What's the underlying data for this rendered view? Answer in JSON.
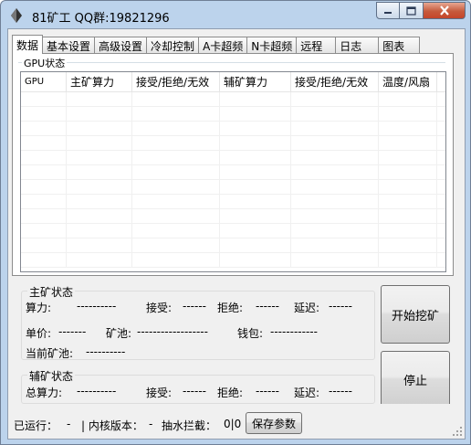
{
  "window": {
    "title": "81矿工  QQ群:19821296",
    "controls": {
      "minimize": "minimize",
      "maximize": "maximize",
      "close": "close"
    }
  },
  "tabs": [
    "数据",
    "基本设置",
    "高级设置",
    "冷却控制",
    "A卡超频",
    "N卡超频",
    "远程",
    "日志",
    "图表"
  ],
  "active_tab": "数据",
  "gpu_status": {
    "group_label": "GPU状态",
    "columns": [
      "GPU",
      "主矿算力",
      "接受/拒绝/无效",
      "辅矿算力",
      "接受/拒绝/无效",
      "温度/风扇"
    ],
    "rows": []
  },
  "main_status": {
    "group_label": "主矿状态",
    "hashrate_label": "算力:",
    "hashrate_value": "----------",
    "accepted_label": "接受:",
    "accepted_value": "------",
    "rejected_label": "拒绝:",
    "rejected_value": "------",
    "latency_label": "延迟:",
    "latency_value": "------",
    "price_label": "单价:",
    "price_value": "-------",
    "pool_label": "矿池:",
    "pool_value": "------------------",
    "wallet_label": "钱包:",
    "wallet_value": "------------",
    "current_pool_label": "当前矿池:",
    "current_pool_value": "----------"
  },
  "aux_status": {
    "group_label": "辅矿状态",
    "hashrate_label": "总算力:",
    "hashrate_value": "----------",
    "accepted_label": "接受:",
    "accepted_value": "------",
    "rejected_label": "拒绝:",
    "rejected_value": "------",
    "latency_label": "延迟:",
    "latency_value": "------"
  },
  "buttons": {
    "start": "开始挖矿",
    "stop": "停止",
    "save": "保存参数"
  },
  "statusbar": {
    "running_label": "已运行：",
    "running_value": "-",
    "kernel_label": "| 内核版本：",
    "kernel_value": "-",
    "fee_label": "抽水拦截：",
    "fee_value": "0|0"
  },
  "icons": [
    "miner-app-icon",
    "minimize-icon",
    "maximize-icon",
    "close-icon",
    "resize-grip-icon"
  ]
}
